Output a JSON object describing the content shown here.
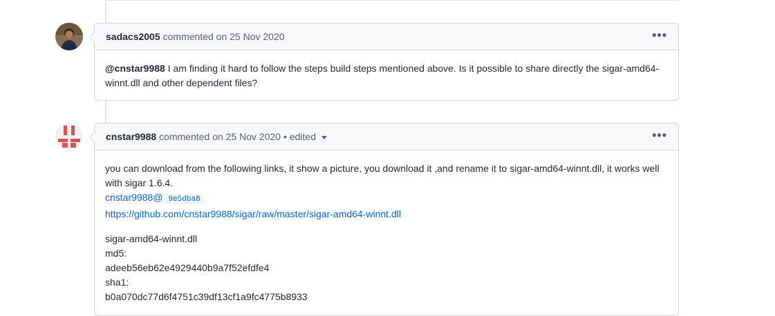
{
  "comments": [
    {
      "author": "sadacs2005",
      "meta": "commented on 25 Nov 2020",
      "menu_icon": "•••",
      "body": {
        "mention": "@cnstar9988",
        "text": " I am finding it hard to follow the steps build steps mentioned above. Is it possible to share directly the sigar-amd64-winnt.dll and other dependent files?"
      }
    },
    {
      "author": "cnstar9988",
      "meta": "commented on 25 Nov 2020",
      "edited": "• edited",
      "menu_icon": "•••",
      "body": {
        "line1": "you can download from the following links, it show a picture, you download it ,and rename it to sigar-amd64-winnt.dll, it works well with sigar 1.6.4.",
        "commit_ref": "cnstar9988@",
        "commit_sha": "9e5dba8",
        "url": "https://github.com/cnstar9988/sigar/raw/master/sigar-amd64-winnt.dll",
        "file_name": "sigar-amd64-winnt.dll",
        "md5_label": "md5:",
        "md5_value": "adeeb56eb62e4929440b9a7f52efdfe4",
        "sha1_label": "sha1:",
        "sha1_value": "b0a070dc77d6f4751c39df13cf1a9fc4775b8933"
      }
    }
  ]
}
